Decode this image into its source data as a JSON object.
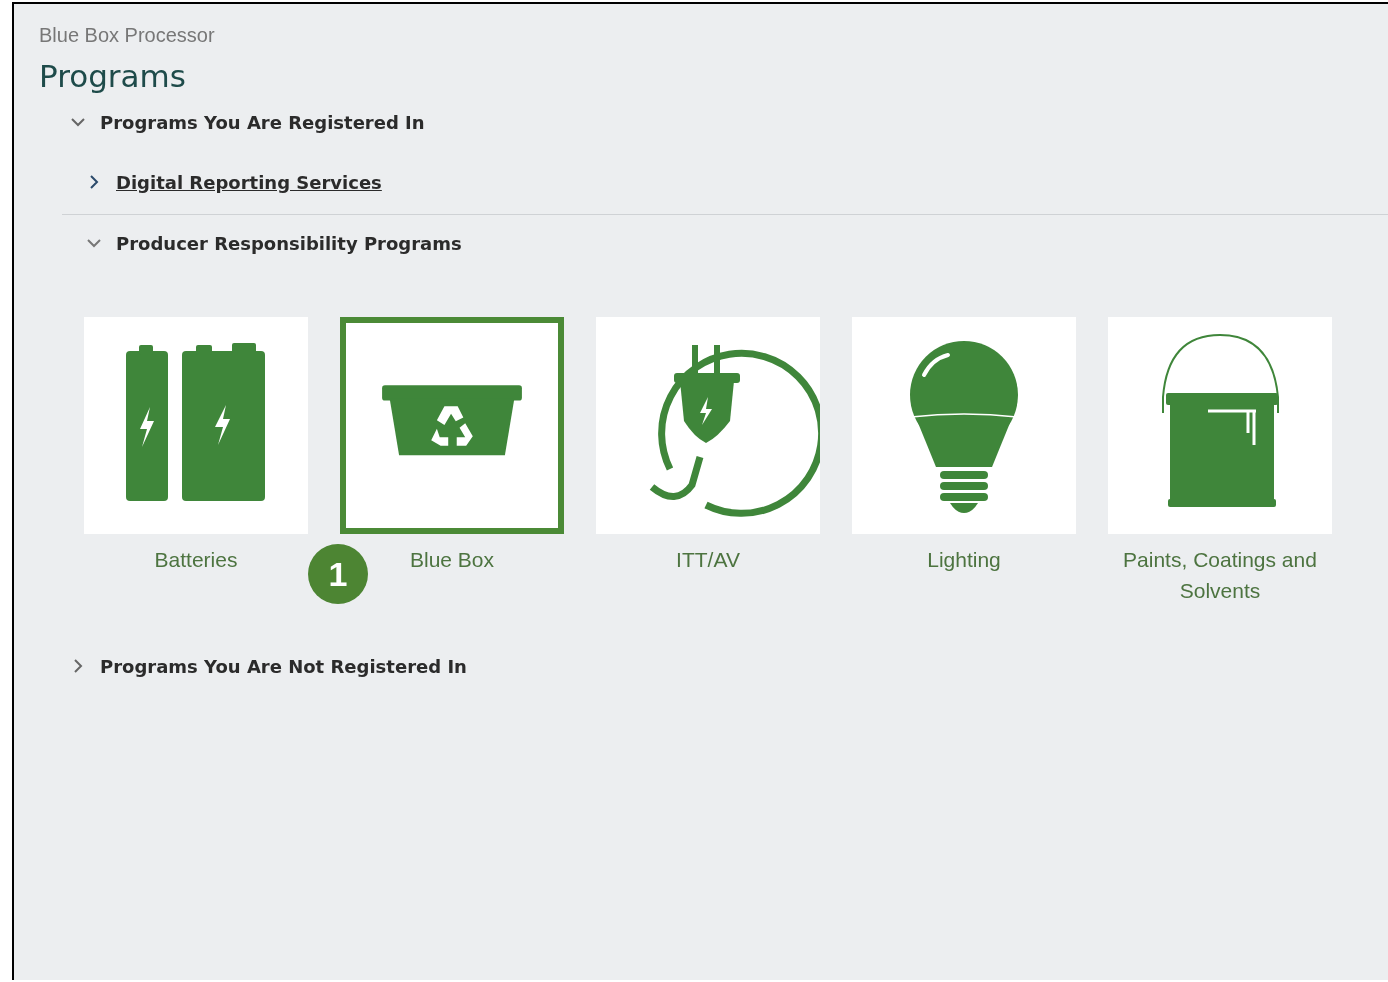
{
  "breadcrumb": "Blue Box Processor",
  "title": "Programs",
  "sections": [
    {
      "label": "Programs You Are Registered In",
      "expanded": true,
      "children": [
        {
          "kind": "link",
          "label": "Digital Reporting Services",
          "expanded": false
        },
        {
          "kind": "group",
          "label": "Producer Responsibility Programs",
          "expanded": true,
          "programs": [
            {
              "kind": "batteries",
              "label": "Batteries",
              "selected": false
            },
            {
              "kind": "bin",
              "label": "Blue Box",
              "selected": true,
              "callout": "1"
            },
            {
              "kind": "plug",
              "label": "ITT/AV",
              "selected": false
            },
            {
              "kind": "bulb",
              "label": "Lighting",
              "selected": false
            },
            {
              "kind": "paint",
              "label": "Paints, Coatings and Solvents",
              "selected": false
            }
          ]
        }
      ]
    },
    {
      "label": "Programs You Are Not Registered In",
      "expanded": false
    }
  ]
}
